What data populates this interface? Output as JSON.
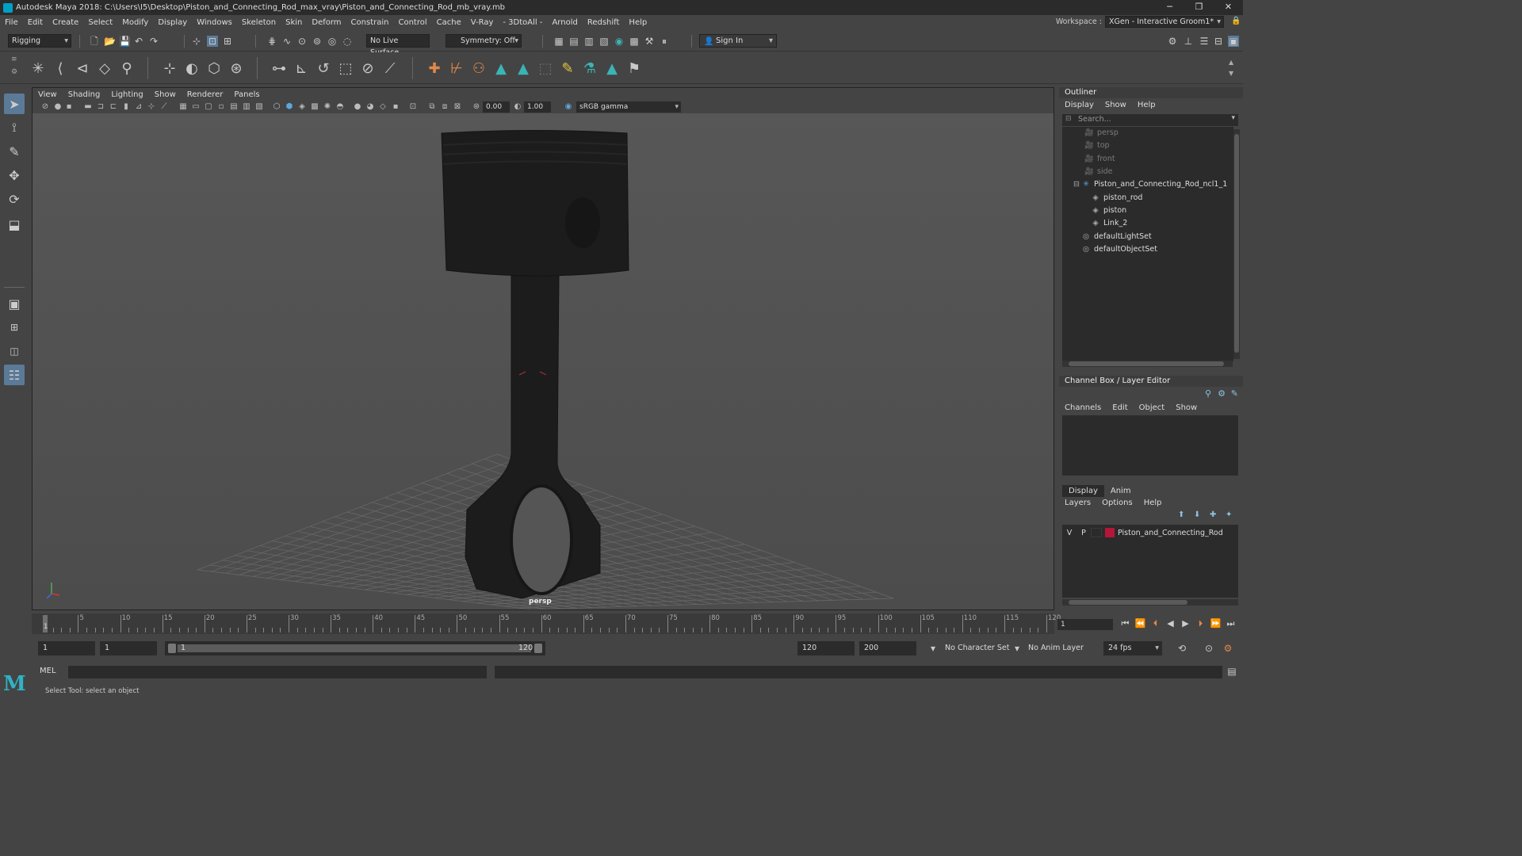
{
  "window": {
    "title": "Autodesk Maya 2018: C:\\Users\\I5\\Desktop\\Piston_and_Connecting_Rod_max_vray\\Piston_and_Connecting_Rod_mb_vray.mb",
    "controls": [
      "─",
      "❐",
      "✕"
    ]
  },
  "menus": [
    "File",
    "Edit",
    "Create",
    "Select",
    "Modify",
    "Display",
    "Windows",
    "Skeleton",
    "Skin",
    "Deform",
    "Constrain",
    "Control",
    "Cache",
    "V-Ray",
    "- 3DtoAll -",
    "Arnold",
    "Redshift",
    "Help"
  ],
  "workspace": {
    "label": "Workspace :",
    "value": "XGen - Interactive Groom1*"
  },
  "statusline": {
    "menuset": "Rigging",
    "live_surface": "No Live Surface",
    "symmetry": "Symmetry: Off",
    "signin": "Sign In"
  },
  "viewport": {
    "menus": [
      "View",
      "Shading",
      "Lighting",
      "Show",
      "Renderer",
      "Panels"
    ],
    "exposure": "0.00",
    "gamma": "1.00",
    "colorspace": "sRGB gamma",
    "camera_label": "persp"
  },
  "outliner": {
    "title": "Outliner",
    "menus": [
      "Display",
      "Show",
      "Help"
    ],
    "search_placeholder": "Search...",
    "items": [
      {
        "label": "persp",
        "icon": "🎥",
        "dim": true
      },
      {
        "label": "top",
        "icon": "🎥",
        "dim": true
      },
      {
        "label": "front",
        "icon": "🎥",
        "dim": true
      },
      {
        "label": "side",
        "icon": "🎥",
        "dim": true
      },
      {
        "label": "Piston_and_Connecting_Rod_ncl1_1",
        "icon": "✳",
        "dim": false
      },
      {
        "label": "piston_rod",
        "icon": "◈",
        "dim": false
      },
      {
        "label": "piston",
        "icon": "◈",
        "dim": false
      },
      {
        "label": "Link_2",
        "icon": "◈",
        "dim": false
      },
      {
        "label": "defaultLightSet",
        "icon": "◎",
        "dim": false
      },
      {
        "label": "defaultObjectSet",
        "icon": "◎",
        "dim": false
      }
    ]
  },
  "channelbox": {
    "title": "Channel Box / Layer Editor",
    "menus": [
      "Channels",
      "Edit",
      "Object",
      "Show"
    ],
    "tabs": [
      "Display",
      "Anim"
    ],
    "layer_menus": [
      "Layers",
      "Options",
      "Help"
    ],
    "layer": {
      "v": "V",
      "p": "P",
      "name": "Piston_and_Connecting_Rod",
      "color": "#b5163a"
    }
  },
  "timeline": {
    "tick_labels": [
      "5",
      "10",
      "15",
      "20",
      "25",
      "30",
      "35",
      "40",
      "45",
      "50",
      "55",
      "60",
      "65",
      "70",
      "75",
      "80",
      "85",
      "90",
      "95",
      "100",
      "105",
      "110",
      "115",
      "120"
    ],
    "current_frame_label": "1",
    "current_frame": "1"
  },
  "range": {
    "start": "1",
    "playback_start": "1",
    "bar_start": "1",
    "bar_end": "120",
    "playback_end": "120",
    "end": "200",
    "character_set": "No Character Set",
    "anim_layer": "No Anim Layer",
    "fps": "24 fps"
  },
  "cmdline": {
    "label": "MEL"
  },
  "helpline": "Select Tool: select an object",
  "logo": "M"
}
